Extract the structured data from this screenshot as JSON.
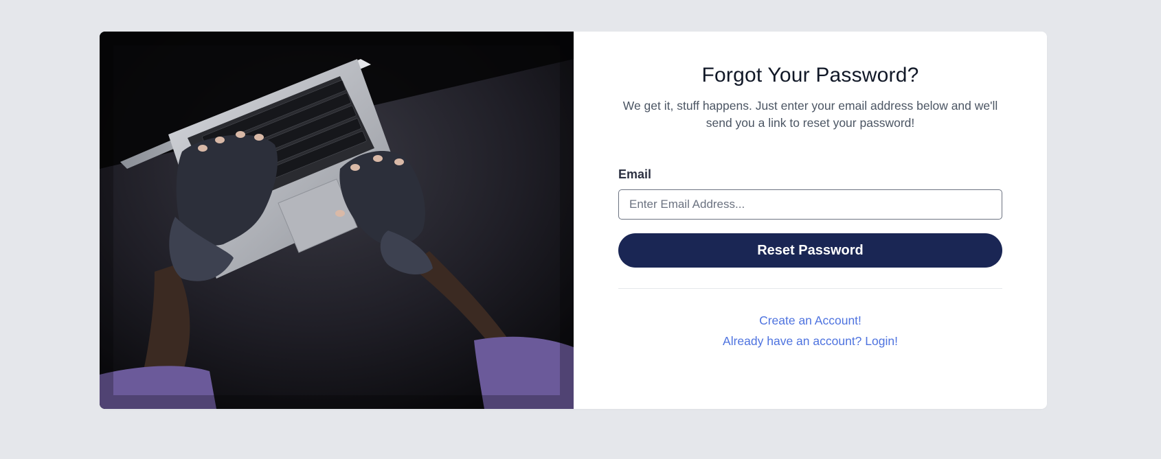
{
  "page": {
    "title": "Forgot Your Password?",
    "subtitle": "We get it, stuff happens. Just enter your email address below and we'll send you a link to reset your password!"
  },
  "form": {
    "email_label": "Email",
    "email_placeholder": "Enter Email Address...",
    "email_value": "",
    "submit_label": "Reset Password"
  },
  "links": {
    "create_account": "Create an Account!",
    "login": "Already have an account? Login!"
  },
  "image": {
    "description_icon": "hands-typing-on-laptop-image"
  },
  "colors": {
    "background": "#e5e7eb",
    "button": "#1a2654",
    "link": "#4e73df"
  }
}
